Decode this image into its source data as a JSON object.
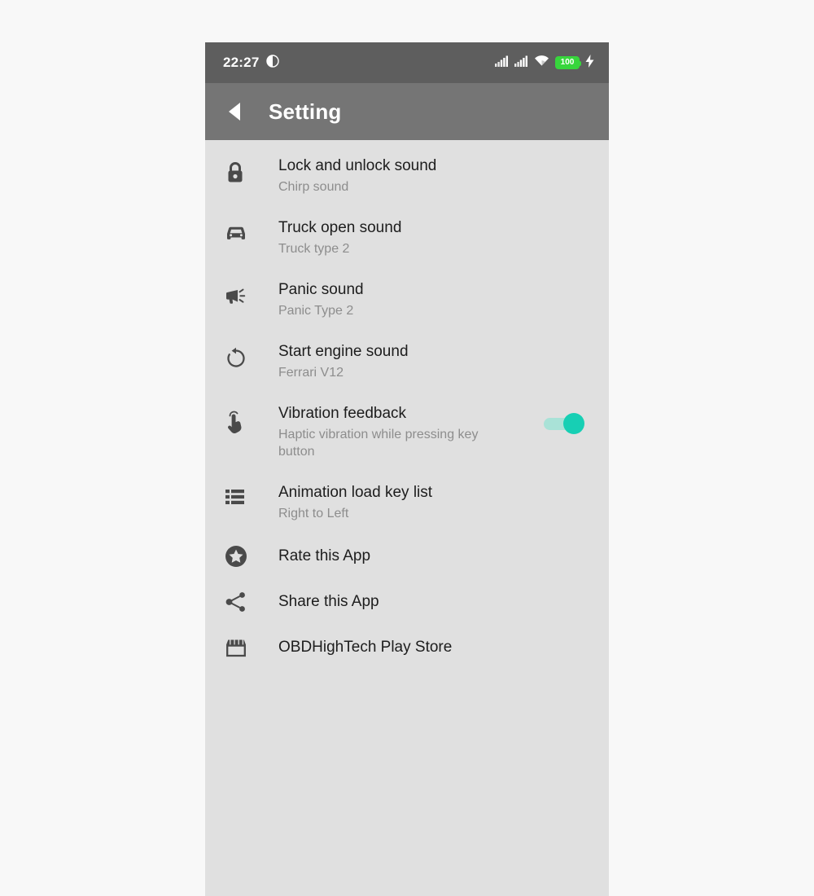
{
  "status_bar": {
    "time": "22:27",
    "clock_icon": "dnd-circle-icon",
    "signal_1_icon": "cellular-signal-icon",
    "signal_2_icon": "cellular-signal-icon",
    "wifi_icon": "wifi-icon",
    "battery_level": "100",
    "battery_icon": "battery-icon",
    "charging_icon": "lightning-bolt-icon",
    "background_color": "#5e5e5e"
  },
  "app_bar": {
    "back_icon": "back-arrow-icon",
    "title": "Setting",
    "background_color": "#757575"
  },
  "theme": {
    "content_background": "#e0e0e0",
    "title_color": "#1d1d1d",
    "subtitle_color": "#8d8d8d",
    "icon_color": "#4a4a4a",
    "toggle_on_color": "#17cfb4",
    "toggle_track_color": "#a9e2d7",
    "battery_green": "#37d63c"
  },
  "settings": {
    "items": [
      {
        "icon": "lock-icon",
        "title": "Lock and unlock sound",
        "subtitle": "Chirp sound",
        "has_toggle": false
      },
      {
        "icon": "car-front-icon",
        "title": "Truck open sound",
        "subtitle": "Truck type 2",
        "has_toggle": false
      },
      {
        "icon": "megaphone-icon",
        "title": "Panic sound",
        "subtitle": "Panic Type 2",
        "has_toggle": false
      },
      {
        "icon": "restart-rotate-icon",
        "title": "Start engine sound",
        "subtitle": "Ferrari V12",
        "has_toggle": false
      },
      {
        "icon": "touch-tap-icon",
        "title": "Vibration feedback",
        "subtitle": "Haptic vibration while pressing key button",
        "has_toggle": true,
        "toggle_state": "on"
      },
      {
        "icon": "list-icon",
        "title": "Animation load key list",
        "subtitle": "Right to Left",
        "has_toggle": false
      },
      {
        "icon": "star-circle-icon",
        "title": "Rate this App",
        "subtitle": "",
        "has_toggle": false
      },
      {
        "icon": "share-icon",
        "title": "Share this App",
        "subtitle": "",
        "has_toggle": false
      },
      {
        "icon": "storefront-icon",
        "title": "OBDHighTech Play Store",
        "subtitle": "",
        "has_toggle": false
      }
    ]
  }
}
